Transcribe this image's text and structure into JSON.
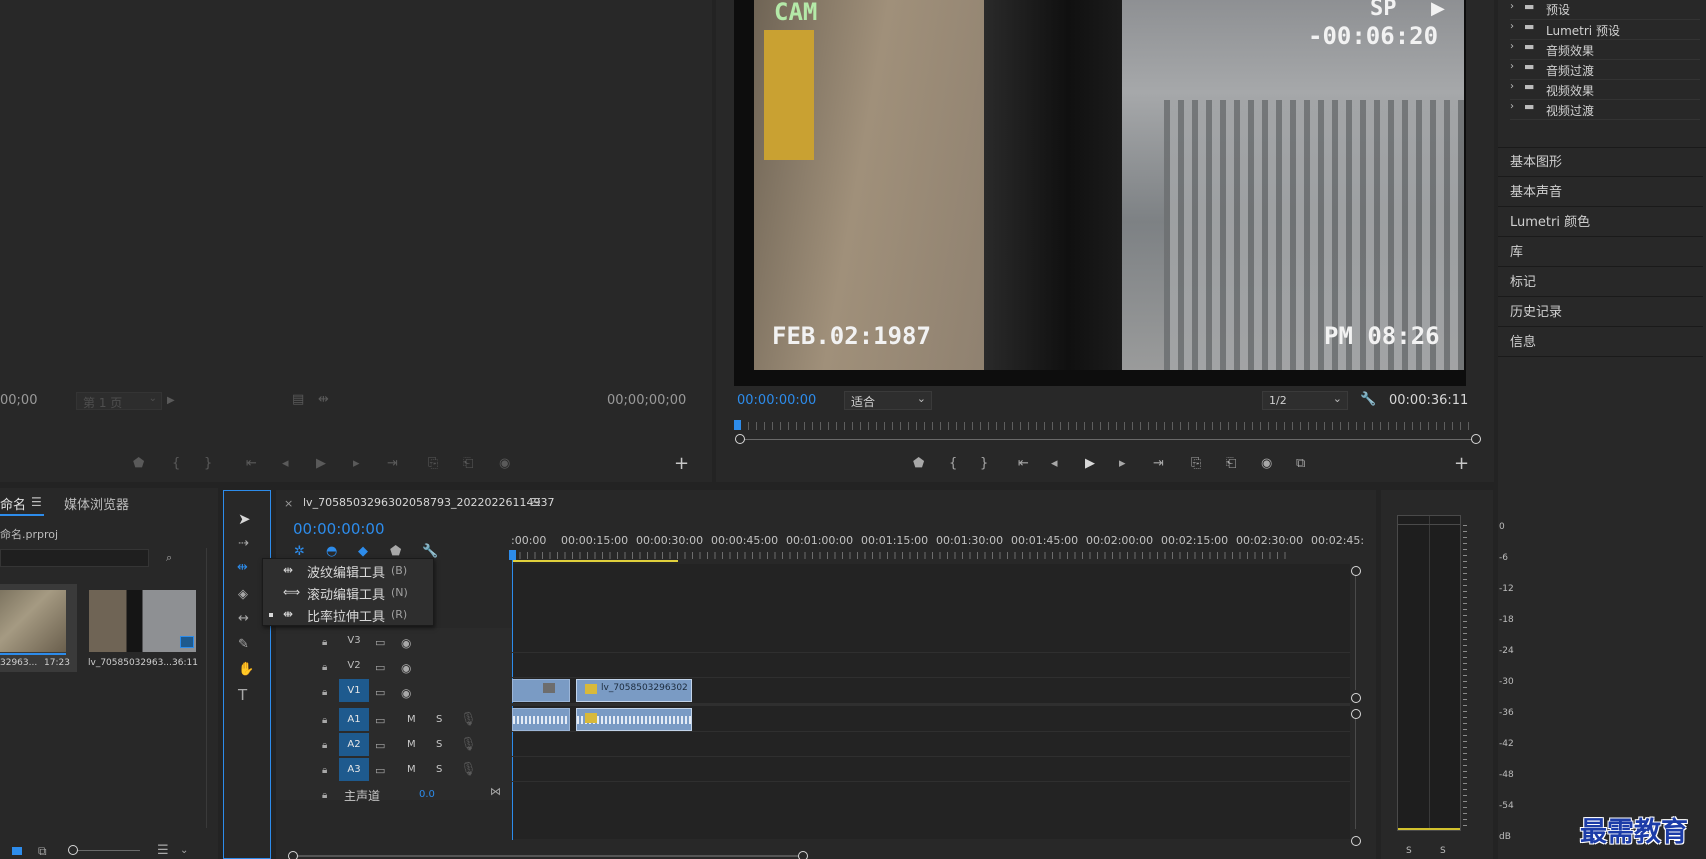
{
  "source_monitor": {
    "timecode_left": "00;00",
    "page_select": "第 1 页",
    "timecode_right": "00;00;00;00"
  },
  "program_monitor": {
    "timecode_current": "00:00:00:00",
    "fit_select": "适合",
    "resolution_select": "1/2",
    "timecode_duration": "00:00:36:11",
    "frame_text": {
      "cam": "CAM",
      "sp": "SP",
      "countdown": "-00:06:20",
      "date": "FEB.02:1987",
      "time": "PM 08:26"
    }
  },
  "effects_panel": {
    "folders": [
      "预设",
      "Lumetri 预设",
      "音频效果",
      "音频过渡",
      "视频效果",
      "视频过渡"
    ]
  },
  "right_panel": {
    "items": [
      "基本图形",
      "基本声音",
      "Lumetri 颜色",
      "库",
      "标记",
      "历史记录",
      "信息"
    ]
  },
  "project_panel": {
    "tab_project": "命名",
    "tab_media_browser": "媒体浏览器",
    "project_file": "命名.prproj",
    "clips": [
      {
        "name": "32963...",
        "duration": "17:23"
      },
      {
        "name": "lv_70585032963...",
        "duration": "36:11"
      }
    ]
  },
  "tools_flyout": {
    "items": [
      {
        "label": "波纹编辑工具",
        "shortcut": "(B)"
      },
      {
        "label": "滚动编辑工具",
        "shortcut": "(N)"
      },
      {
        "label": "比率拉伸工具",
        "shortcut": "(R)"
      }
    ]
  },
  "timeline": {
    "sequence_name": "lv_7058503296302058793_20220226114937",
    "timecode": "00:00:00:00",
    "ruler_labels": [
      ":00:00",
      "00:00:15:00",
      "00:00:30:00",
      "00:00:45:00",
      "00:01:00:00",
      "00:01:15:00",
      "00:01:30:00",
      "00:01:45:00",
      "00:02:00:00",
      "00:02:15:00",
      "00:02:30:00",
      "00:02:45:"
    ],
    "video_tracks": [
      "V3",
      "V2",
      "V1"
    ],
    "audio_tracks": [
      "A1",
      "A2",
      "A3"
    ],
    "mute_label": "M",
    "solo_label": "S",
    "master_label": "主声道",
    "master_value": "0.0",
    "clip_name": "lv_7058503296302"
  },
  "audio_meter": {
    "scale": [
      "0",
      "-6",
      "-12",
      "-18",
      "-24",
      "-30",
      "-36",
      "-42",
      "-48",
      "-54",
      "dB"
    ],
    "solo_left": "S",
    "solo_right": "S"
  },
  "watermark": "最需教育"
}
